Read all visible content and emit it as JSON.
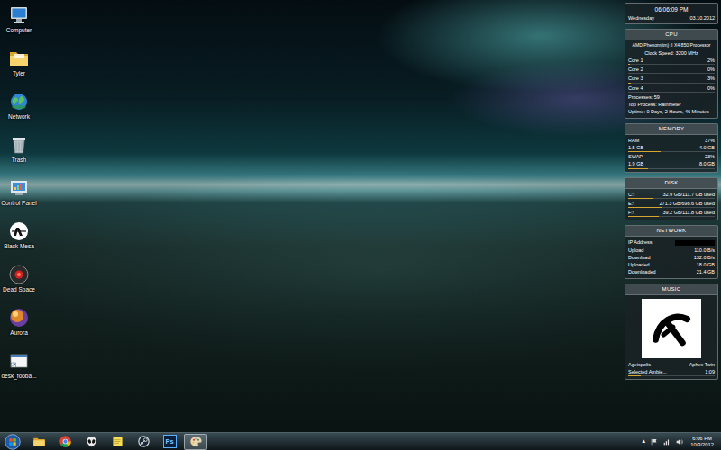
{
  "desktop_icons": [
    {
      "label": "Computer",
      "kind": "computer"
    },
    {
      "label": "Tyler",
      "kind": "folder"
    },
    {
      "label": "Network",
      "kind": "network"
    },
    {
      "label": "Trash",
      "kind": "trash"
    },
    {
      "label": "Control Panel",
      "kind": "control-panel"
    },
    {
      "label": "Black Mesa",
      "kind": "black-mesa"
    },
    {
      "label": "Dead Space",
      "kind": "dead-space"
    },
    {
      "label": "Aurora",
      "kind": "aurora"
    },
    {
      "label": "desk_fooba...",
      "kind": "shortcut"
    }
  ],
  "clock": {
    "time": "06:06:09 PM",
    "day": "Wednesday",
    "date": "03.10.2012"
  },
  "cpu": {
    "title": "CPU",
    "model": "AMD Phenom(tm) II X4 850 Processor",
    "clock_speed": "Clock Speed: 3200 MHz",
    "cores": [
      {
        "label": "Core 1",
        "reading": "2%",
        "level": 0.02
      },
      {
        "label": "Core 2",
        "reading": "0%",
        "level": 0.0
      },
      {
        "label": "Core 3",
        "reading": "3%",
        "level": 0.03
      },
      {
        "label": "Core 4",
        "reading": "0%",
        "level": 0.0
      }
    ],
    "processes": "Processes: 59",
    "top_process": "Top Process: Rainmeter",
    "uptime": "Uptime: 0 Days, 2 Hours, 46 Minutes"
  },
  "memory": {
    "title": "MEMORY",
    "rows": [
      {
        "label": "RAM",
        "reading": "37%",
        "used": "1.5 GB",
        "total": "4.0 GB",
        "level": 0.37
      },
      {
        "label": "SWAP",
        "reading": "23%",
        "used": "1.9 GB",
        "total": "8.0 GB",
        "level": 0.23
      }
    ]
  },
  "disk": {
    "title": "DISK",
    "drives": [
      {
        "label": "C:\\",
        "usage": "32.9 GB/111.7 GB used",
        "level": 0.29
      },
      {
        "label": "E:\\",
        "usage": "271.3 GB/698.6 GB used",
        "level": 0.39
      },
      {
        "label": "F:\\",
        "usage": "39.2 GB/111.8 GB used",
        "level": 0.35
      }
    ]
  },
  "network": {
    "title": "NETWORK",
    "ip_label": "IP Address",
    "ip_hidden": true,
    "rows": [
      {
        "label": "Upload",
        "value": "110.0 B/s"
      },
      {
        "label": "Download",
        "value": "132.0 B/s"
      },
      {
        "label": "Uploaded",
        "value": "18.0 GB"
      },
      {
        "label": "Downloaded",
        "value": "21.4 GB"
      }
    ]
  },
  "music": {
    "title": "MUSIC",
    "track": "Ageispolis",
    "artist": "Aphex Twin",
    "album": "Selected Ambie...",
    "time": "1:09",
    "level": 0.15
  },
  "taskbar": {
    "apps": [
      {
        "kind": "explorer",
        "running": false
      },
      {
        "kind": "chrome",
        "running": false
      },
      {
        "kind": "alien",
        "running": false
      },
      {
        "kind": "notes",
        "running": false
      },
      {
        "kind": "steam",
        "running": false
      },
      {
        "kind": "photoshop",
        "label": "Ps",
        "running": false
      },
      {
        "kind": "paint",
        "running": true
      }
    ],
    "tray": {
      "arrow": "▲",
      "time": "6:06 PM",
      "date": "10/3/2012"
    }
  }
}
